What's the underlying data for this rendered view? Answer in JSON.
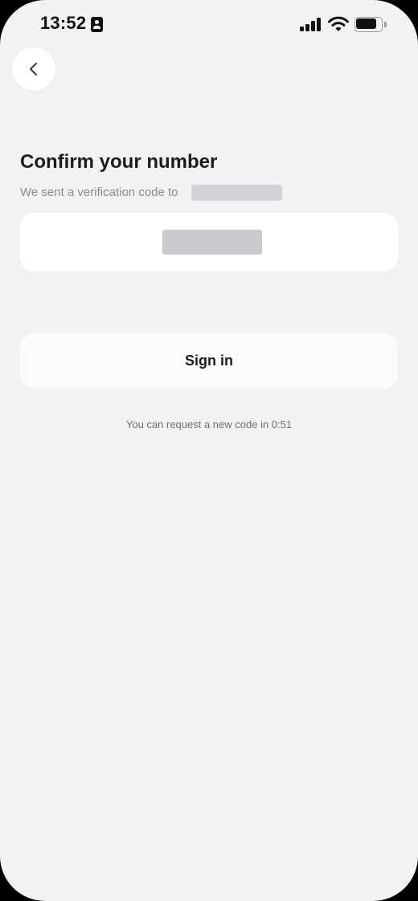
{
  "status_bar": {
    "time": "13:52",
    "signal_bars": 4,
    "battery_level": 0.8
  },
  "icons": {
    "back": "chevron-left-icon",
    "contact": "contact-card-icon",
    "signal": "cellular-signal-icon",
    "wifi": "wifi-icon",
    "battery": "battery-icon"
  },
  "colors": {
    "background": "#f2f2f4",
    "card": "#ffffff",
    "redaction": "#d1d1d6",
    "muted_text": "#8a8a8e"
  },
  "header": {
    "title": "Confirm your number",
    "subtitle": "We sent a verification code to"
  },
  "form": {
    "sign_in_label": "Sign in",
    "resend_text": "You can request a new code in 0:51"
  }
}
